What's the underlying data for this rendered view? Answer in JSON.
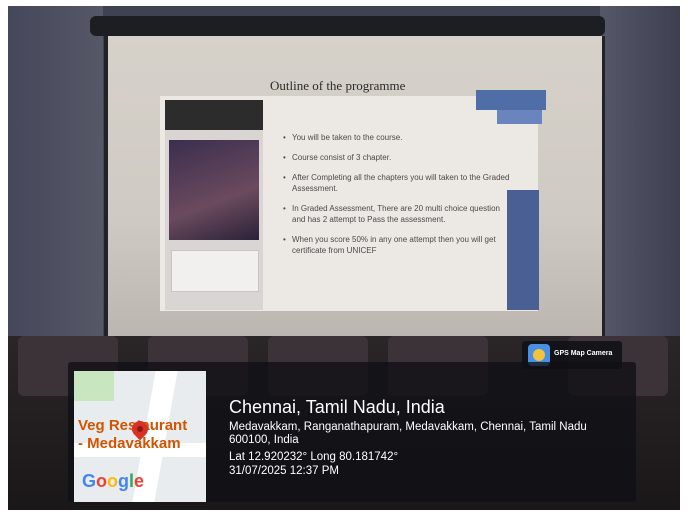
{
  "slide": {
    "title": "Outline of the programme",
    "bullets": [
      "You will be taken to the course.",
      "Course consist of 3 chapter.",
      "After Completing all the chapters you will taken to the Graded Assessment.",
      "In Graded Assessment, There are 20 multi choice question and has 2 attempt to Pass the assessment.",
      "When you score 50% in any one attempt then you will get certificate from UNICEF"
    ]
  },
  "gps_overlay": {
    "app_name": "GPS Map Camera",
    "location_title": "Chennai, Tamil Nadu, India",
    "address": "Medavakkam, Ranganathapuram, Medavakkam, Chennai, Tamil Nadu 600100, India",
    "coordinates": "Lat 12.920232° Long 80.181742°",
    "datetime": "31/07/2025 12:37 PM"
  },
  "map": {
    "place_label": "Veg Restaurant - Medavakkam",
    "place_label_line1": "Veg Restaurant",
    "place_label_line2": "- Medavakkam",
    "brand": "Google",
    "icon": "map-pin-icon"
  },
  "colors": {
    "overlay_bg": "#0f0f14",
    "map_label": "#d35400",
    "pin": "#d93025",
    "slide_accent": "#4f6ea8"
  }
}
